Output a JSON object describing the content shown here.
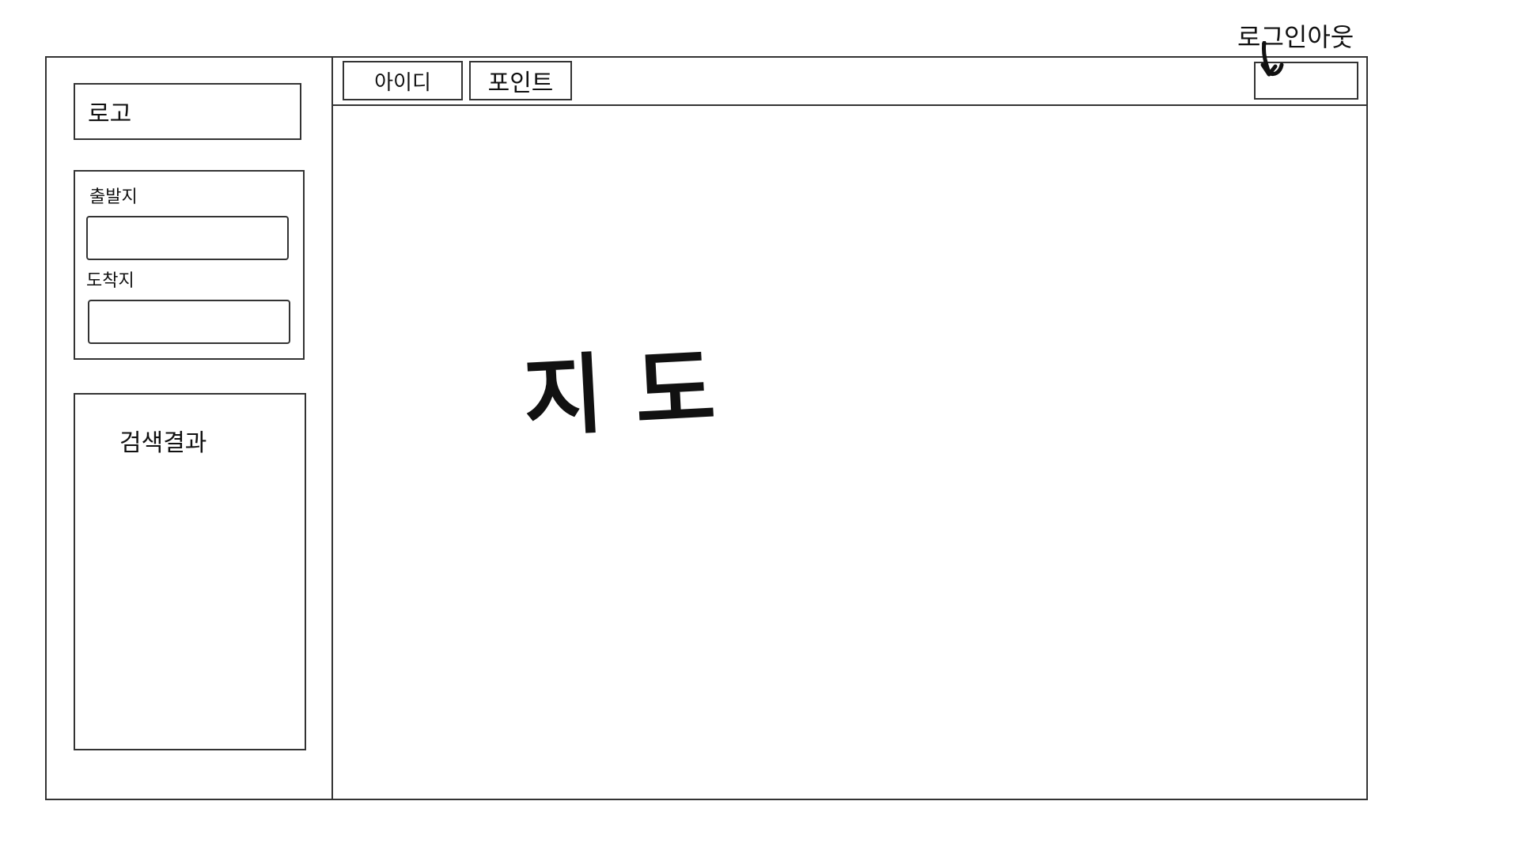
{
  "sidebar": {
    "logo": "로고",
    "search": {
      "origin_label": "출발지",
      "origin_value": "",
      "destination_label": "도착지",
      "destination_value": ""
    },
    "results": {
      "title": "검색결과"
    }
  },
  "topbar": {
    "user_id": "아이디",
    "points": "포인트",
    "auth_label": "로그인아웃"
  },
  "map": {
    "title": "지도"
  }
}
